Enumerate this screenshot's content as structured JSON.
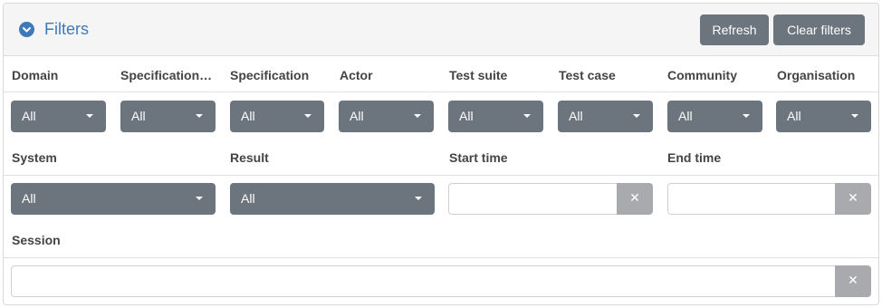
{
  "header": {
    "title": "Filters",
    "toggle_icon": "chevron-down-circle-icon",
    "refresh_label": "Refresh",
    "clear_label": "Clear filters"
  },
  "row1": {
    "labels": [
      "Domain",
      "Specification…",
      "Specification",
      "Actor",
      "Test suite",
      "Test case",
      "Community",
      "Organisation"
    ],
    "values": [
      "All",
      "All",
      "All",
      "All",
      "All",
      "All",
      "All",
      "All"
    ]
  },
  "row2": {
    "system_label": "System",
    "system_value": "All",
    "result_label": "Result",
    "result_value": "All",
    "start_label": "Start time",
    "end_label": "End time"
  },
  "row3": {
    "session_label": "Session"
  },
  "clear_glyph": "✕",
  "colors": {
    "accent": "#3e7ab8",
    "dropdown_bg": "#6c757d",
    "clear_bg": "#a8aaad",
    "header_bg": "#f5f5f5"
  }
}
